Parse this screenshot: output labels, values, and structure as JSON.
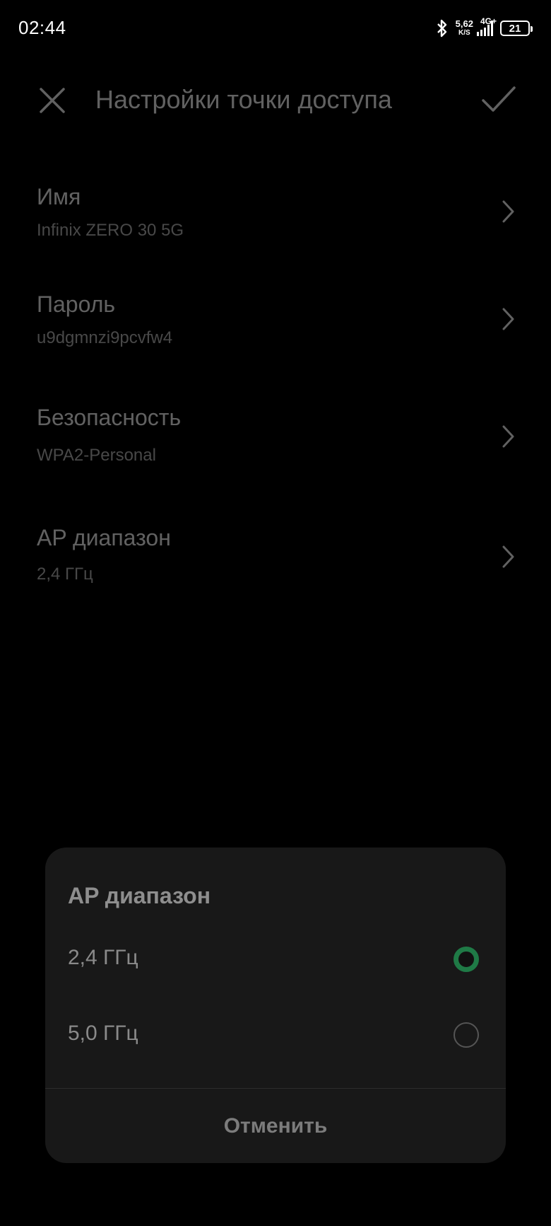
{
  "status_bar": {
    "time": "02:44",
    "net_speed_value": "5,62",
    "net_speed_unit": "K/S",
    "network_type": "4G+",
    "battery_level": "21"
  },
  "toolbar": {
    "title": "Настройки точки доступа",
    "close_icon": "close-icon",
    "confirm_icon": "check-icon"
  },
  "settings": [
    {
      "title": "Имя",
      "value": "Infinix ZERO 30 5G"
    },
    {
      "title": "Пароль",
      "value": "u9dgmnzi9pcvfw4"
    },
    {
      "title": "Безопасность",
      "value": "WPA2-Personal"
    },
    {
      "title": "AP диапазон",
      "value": "2,4 ГГц"
    }
  ],
  "dialog": {
    "title": "AP диапазон",
    "options": [
      {
        "label": "2,4 ГГц",
        "selected": true
      },
      {
        "label": "5,0 ГГц",
        "selected": false
      }
    ],
    "cancel_label": "Отменить",
    "accent_color": "#1f7a46"
  }
}
